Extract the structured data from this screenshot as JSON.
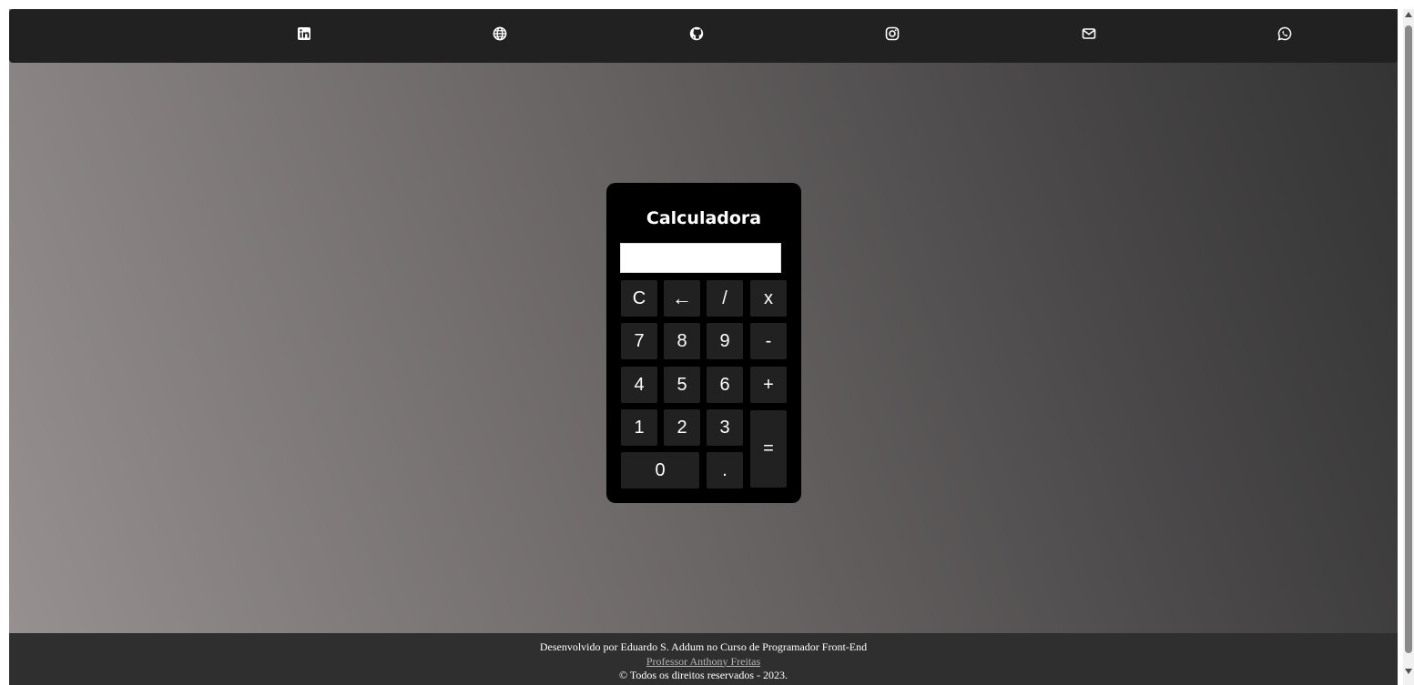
{
  "nav": {
    "icons": [
      {
        "name": "linkedin-icon"
      },
      {
        "name": "globe-icon"
      },
      {
        "name": "github-icon"
      },
      {
        "name": "instagram-icon"
      },
      {
        "name": "envelope-icon"
      },
      {
        "name": "whatsapp-icon"
      }
    ]
  },
  "calculator": {
    "title": "Calculadora",
    "display_value": "",
    "keys": {
      "clear": "C",
      "backspace": "←",
      "divide": "/",
      "multiply": "x",
      "seven": "7",
      "eight": "8",
      "nine": "9",
      "minus": "-",
      "four": "4",
      "five": "5",
      "six": "6",
      "plus": "+",
      "one": "1",
      "two": "2",
      "three": "3",
      "equals": "=",
      "zero": "0",
      "decimal": "."
    }
  },
  "footer": {
    "line1": "Desenvolvido por Eduardo S. Addum no Curso de Programador Front-End",
    "link_text": "Professor Anthony Freitas",
    "line3": "© Todos os direitos reservados - 2023."
  },
  "colors": {
    "navbar": "#212121",
    "calculator_body": "#000000",
    "key": "#212121",
    "footer": "#2f2f2f",
    "gradient_start": "#979191",
    "gradient_end": "#333333"
  }
}
